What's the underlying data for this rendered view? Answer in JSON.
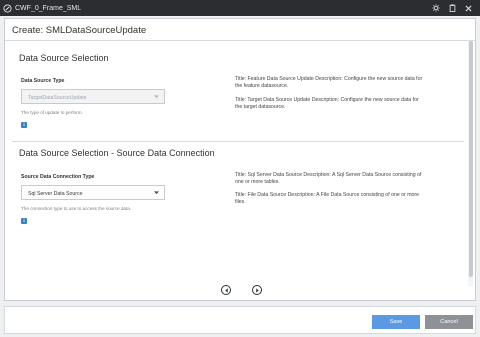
{
  "window": {
    "title": "CWF_0_Frame_SML"
  },
  "dialog": {
    "title": "Create: SMLDataSourceUpdate"
  },
  "section1": {
    "title": "Data Source Selection",
    "field_label": "Data Source Type",
    "select_value": "TargetDataSourceUpdate",
    "hint": "The type of update to perform.",
    "info": "i",
    "descriptions": [
      "Title: Feature Data Source Update Description: Configure the new source data for the feature datasource.",
      "Title: Target Data Source Update Description: Configure the new source data for the target datasource."
    ]
  },
  "section2": {
    "title": "Data Source Selection - Source Data Connection",
    "field_label": "Source Data Connection Type",
    "select_value": "Sql Server Data Source",
    "hint": "The connection type to use to access the source data.",
    "info": "i",
    "descriptions": [
      "Title: Sql Server Data Source Description: A Sql Server Data Source consisting of one or more tables.",
      "Title: File Data Source Description: A File Data Source consisting of one or more files."
    ]
  },
  "footer": {
    "save_label": "Save",
    "cancel_label": "Cancel"
  },
  "colors": {
    "primary": "#5b9ae3",
    "secondary": "#8e9297",
    "titlebar": "#2b2d30",
    "info": "#3b82c4"
  },
  "icons": [
    "app-icon",
    "settings-icon",
    "clipboard-icon",
    "close-icon",
    "chevron-down-icon",
    "info-icon",
    "previous-page-icon",
    "next-page-icon"
  ]
}
